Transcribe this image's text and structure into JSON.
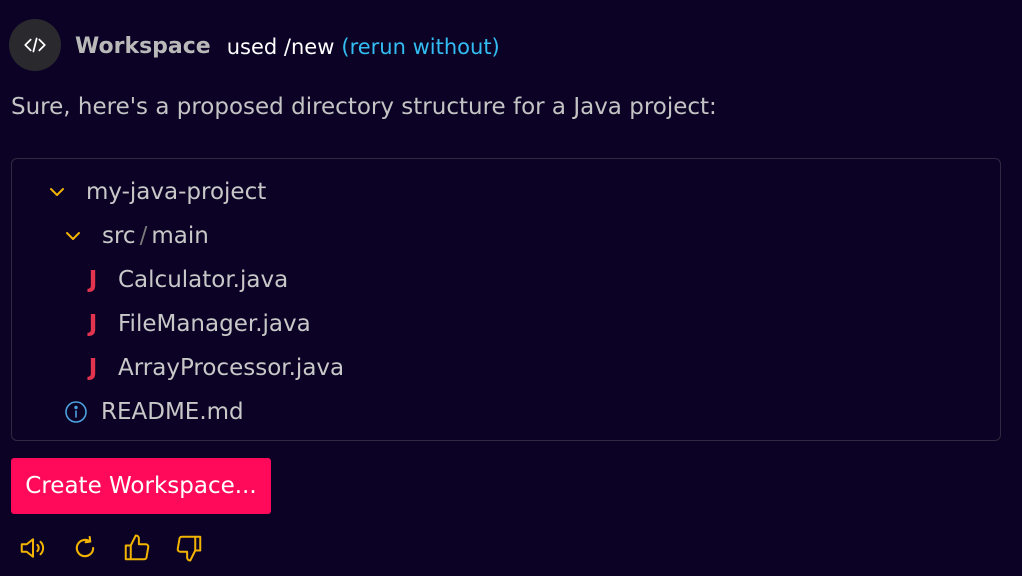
{
  "header": {
    "agent_name": "Workspace",
    "used_text": "used /new",
    "rerun_label": "(rerun without)",
    "avatar_icon": "code-icon"
  },
  "message": {
    "intro": "Sure, here's a proposed directory structure for a Java project:"
  },
  "tree": {
    "root": {
      "name": "my-java-project",
      "icon": "chevron-down-icon"
    },
    "folder": {
      "parent": "src",
      "separator": "/",
      "child": "main",
      "icon": "chevron-down-icon"
    },
    "files": [
      {
        "name": "Calculator.java",
        "icon_glyph": "J"
      },
      {
        "name": "FileManager.java",
        "icon_glyph": "J"
      },
      {
        "name": "ArrayProcessor.java",
        "icon_glyph": "J"
      }
    ],
    "readme": {
      "name": "README.md",
      "icon": "info-icon"
    }
  },
  "actions": {
    "create_label": "Create Workspace...",
    "icons": [
      "speaker-icon",
      "refresh-icon",
      "thumbs-up-icon",
      "thumbs-down-icon"
    ]
  },
  "colors": {
    "background": "#0b0225",
    "accent_button": "#ff0a5a",
    "link": "#33bdf2",
    "chevron": "#f2b400",
    "java_icon": "#e2344f",
    "info_icon": "#4aa3e0",
    "action_icons": "#f2b400"
  }
}
